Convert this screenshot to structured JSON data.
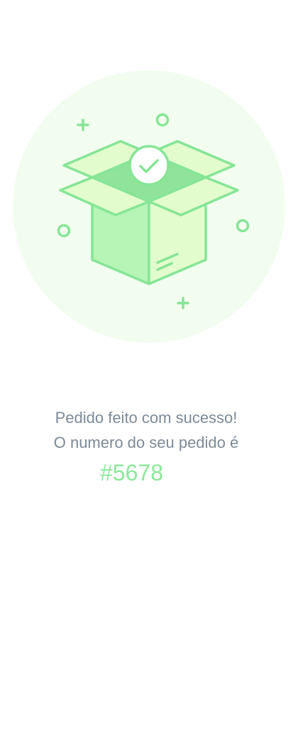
{
  "illustration": {
    "icon": "open-box-with-check-icon",
    "colors": {
      "circle_bg": "#f2fdf0",
      "stroke": "#86e596",
      "fill_light": "#e2fccd",
      "fill_mid": "#b6f5b6",
      "fill_dark": "#8fe49a"
    }
  },
  "confirmation": {
    "line1": "Pedido feito com sucesso!",
    "line2": "O numero do seu pedido é",
    "order_number": "#5678"
  }
}
